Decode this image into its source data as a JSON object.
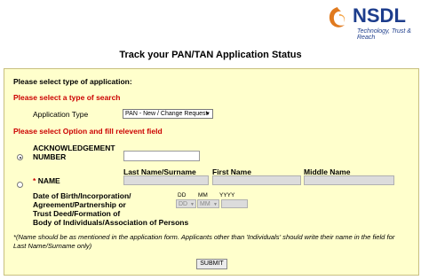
{
  "header": {
    "logo_text": "NSDL",
    "tagline": "Technology, Trust & Reach"
  },
  "page_title": "Track your PAN/TAN Application Status",
  "form": {
    "select_type_label": "Please select type of application:",
    "select_search_label": "Please select a type of search",
    "application_type_label": "Application Type",
    "application_type_value": "PAN - New / Change Request",
    "option_label": "Please select Option and fill relevent field",
    "ack_label_1": "ACKNOWLEDGEMENT",
    "ack_label_2": "NUMBER",
    "col_last_name": "Last Name/Surname",
    "col_first_name": "First Name",
    "col_middle_name": "Middle Name",
    "name_star": "*",
    "name_label": "NAME",
    "dob_label_lines": [
      "Date of Birth/Incorporation/",
      "Agreement/Partnership or",
      "Trust Deed/Formation of",
      "Body of Individuals/Association of Persons"
    ],
    "dd_label": "DD",
    "mm_label": "MM",
    "yyyy_label": "YYYY",
    "dd_value": "DD",
    "mm_value": "MM",
    "note_line_1": "*(Name should be as mentioned in the application form. Applicants other than 'Individuals' should write their name in the field for",
    "note_line_2": "Last Name/Surname only)",
    "submit_label": "SUBMIT"
  }
}
